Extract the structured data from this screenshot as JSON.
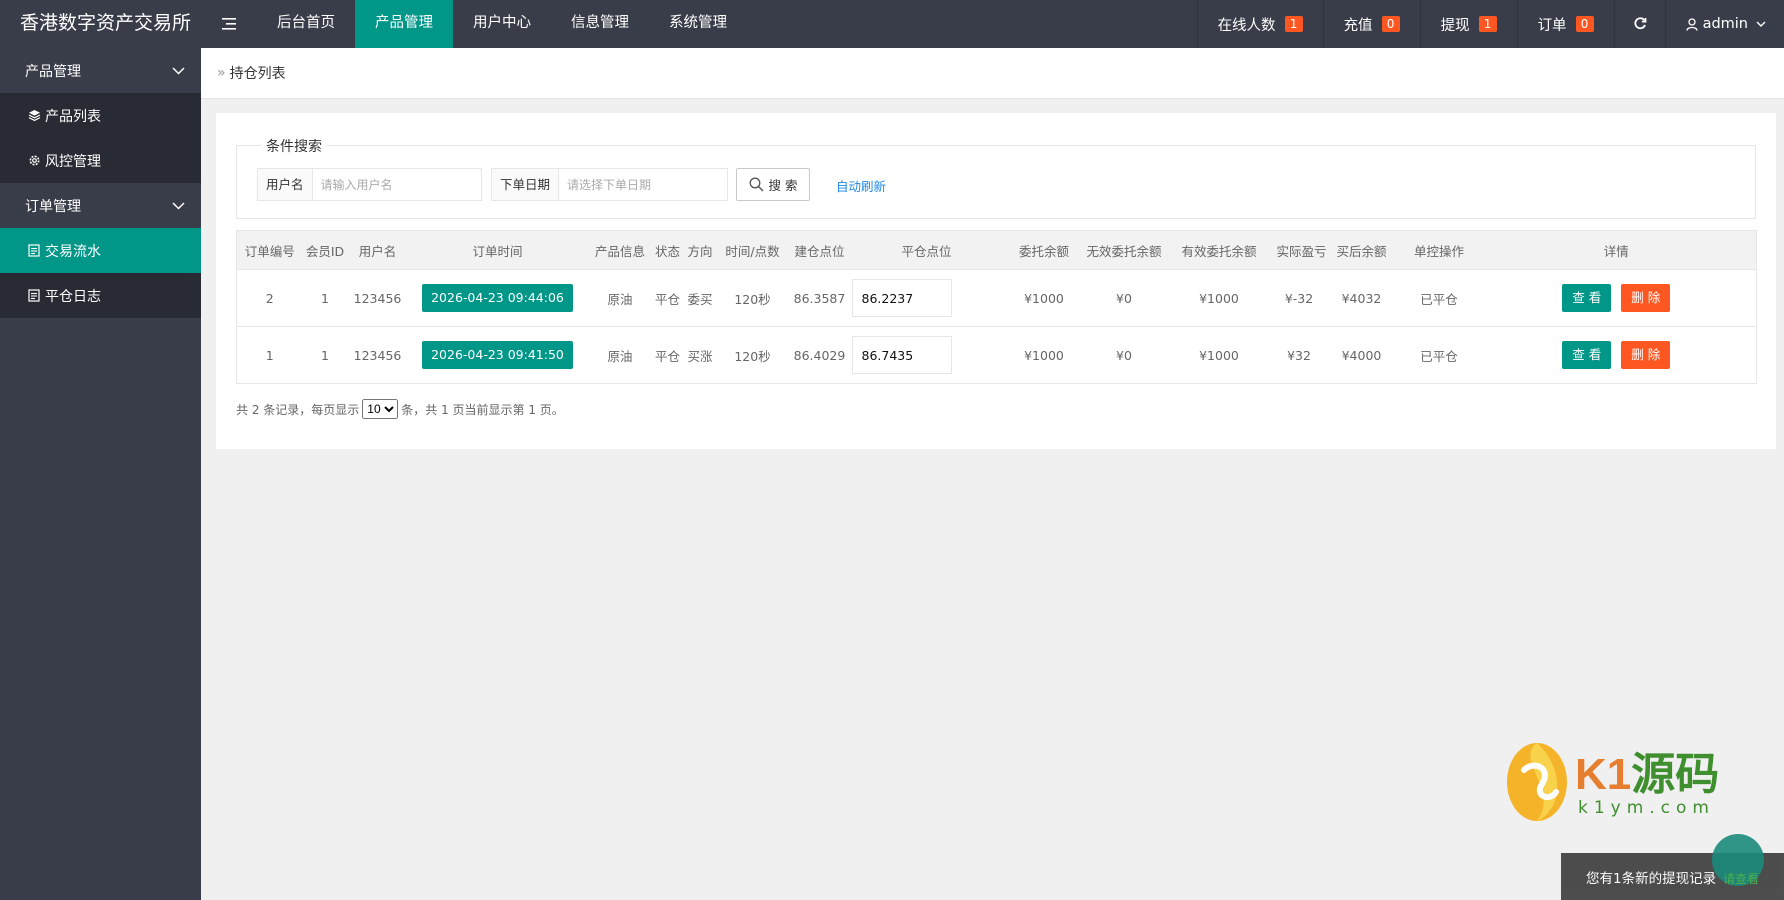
{
  "header": {
    "logo": "香港数字资产交易所",
    "nav": [
      {
        "label": "后台首页",
        "active": false
      },
      {
        "label": "产品管理",
        "active": true
      },
      {
        "label": "用户中心",
        "active": false
      },
      {
        "label": "信息管理",
        "active": false
      },
      {
        "label": "系统管理",
        "active": false
      }
    ],
    "right": {
      "online": {
        "label": "在线人数",
        "count": "1"
      },
      "recharge": {
        "label": "充值",
        "count": "0"
      },
      "withdraw": {
        "label": "提现",
        "count": "1"
      },
      "orders": {
        "label": "订单",
        "count": "0"
      },
      "user": "admin"
    }
  },
  "sidebar": {
    "groups": [
      {
        "label": "产品管理",
        "items": [
          {
            "label": "产品列表",
            "icon": "cube-icon"
          },
          {
            "label": "风控管理",
            "icon": "gear-icon"
          }
        ]
      },
      {
        "label": "订单管理",
        "items": [
          {
            "label": "交易流水",
            "icon": "document-icon",
            "active": true
          },
          {
            "label": "平仓日志",
            "icon": "document-icon"
          }
        ]
      }
    ]
  },
  "breadcrumb": {
    "sep": "»",
    "current": "持仓列表"
  },
  "search": {
    "legend": "条件搜索",
    "username_label": "用户名",
    "username_placeholder": "请输入用户名",
    "date_label": "下单日期",
    "date_placeholder": "请选择下单日期",
    "button": "搜 索",
    "auto_refresh": "自动刷新"
  },
  "table": {
    "headers": [
      "订单编号",
      "会员ID",
      "用户名",
      "订单时间",
      "产品信息",
      "状态",
      "方向",
      "时间/点数",
      "建仓点位",
      "平仓点位",
      "委托余额",
      "无效委托余额",
      "有效委托余额",
      "实际盈亏",
      "买后余额",
      "单控操作",
      "详情"
    ],
    "rows": [
      {
        "id": "2",
        "member_id": "1",
        "username": "123456",
        "time": "2026-04-23 09:44:06",
        "product": "原油",
        "status": "平仓",
        "direction": "委买",
        "duration": "120秒",
        "open_price": "86.3587",
        "close_price": "86.2237",
        "entrust": "¥1000",
        "invalid": "¥0",
        "valid": "¥1000",
        "pnl": "¥-32",
        "after": "¥4032",
        "control": "已平仓",
        "view": "查 看",
        "delete": "删 除"
      },
      {
        "id": "1",
        "member_id": "1",
        "username": "123456",
        "time": "2026-04-23 09:41:50",
        "product": "原油",
        "status": "平仓",
        "direction": "买涨",
        "duration": "120秒",
        "open_price": "86.4029",
        "close_price": "86.7435",
        "entrust": "¥1000",
        "invalid": "¥0",
        "valid": "¥1000",
        "pnl": "¥32",
        "after": "¥4000",
        "control": "已平仓",
        "view": "查 看",
        "delete": "删 除"
      }
    ]
  },
  "pager": {
    "prefix": "共 2 条记录，每页显示",
    "page_size": "10",
    "suffix": "条，共 1 页当前显示第 1 页。"
  },
  "watermark": {
    "brand_a": "K1",
    "brand_b": "源码",
    "url": "k1ym.com"
  },
  "toast": {
    "message": "您有1条新的提现记录",
    "float_label": "请查看"
  }
}
